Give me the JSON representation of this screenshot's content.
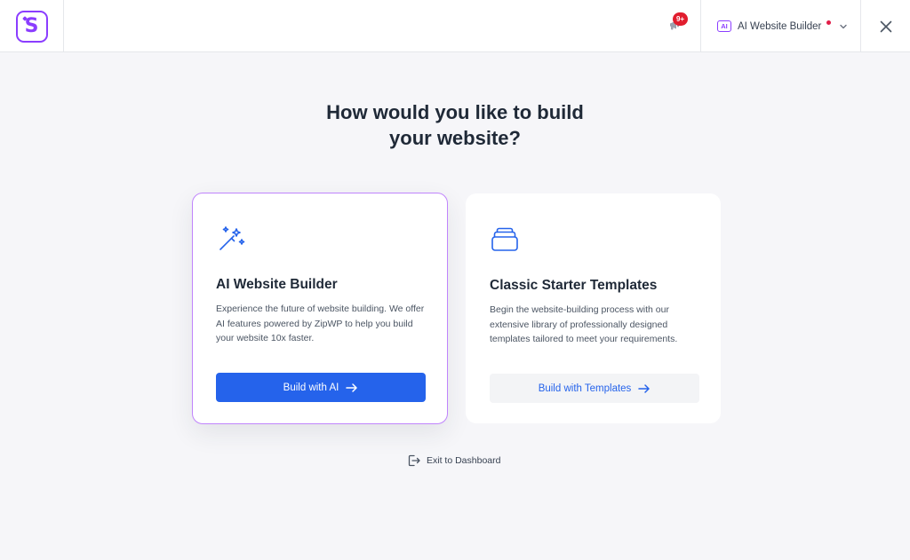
{
  "header": {
    "logo_letter": "S",
    "notification_count": "9+",
    "mode_badge": "AI",
    "mode_label": "AI Website Builder"
  },
  "main": {
    "heading_line1": "How would you like to build",
    "heading_line2": "your website?"
  },
  "cards": {
    "ai": {
      "icon": "magic-wand-icon",
      "title": "AI Website Builder",
      "description": "Experience the future of website building. We offer AI features powered by ZipWP to help you build your website 10x faster.",
      "button": "Build with AI"
    },
    "classic": {
      "icon": "stacked-templates-icon",
      "title": "Classic Starter Templates",
      "description": "Begin the website-building process with our extensive library of professionally designed templates tailored to meet your requirements.",
      "button": "Build with Templates"
    }
  },
  "footer": {
    "exit_label": "Exit to Dashboard"
  },
  "colors": {
    "brand_purple": "#8b3dff",
    "primary_blue": "#2563eb",
    "badge_red": "#e11d2e",
    "background": "#f6f6f9"
  }
}
